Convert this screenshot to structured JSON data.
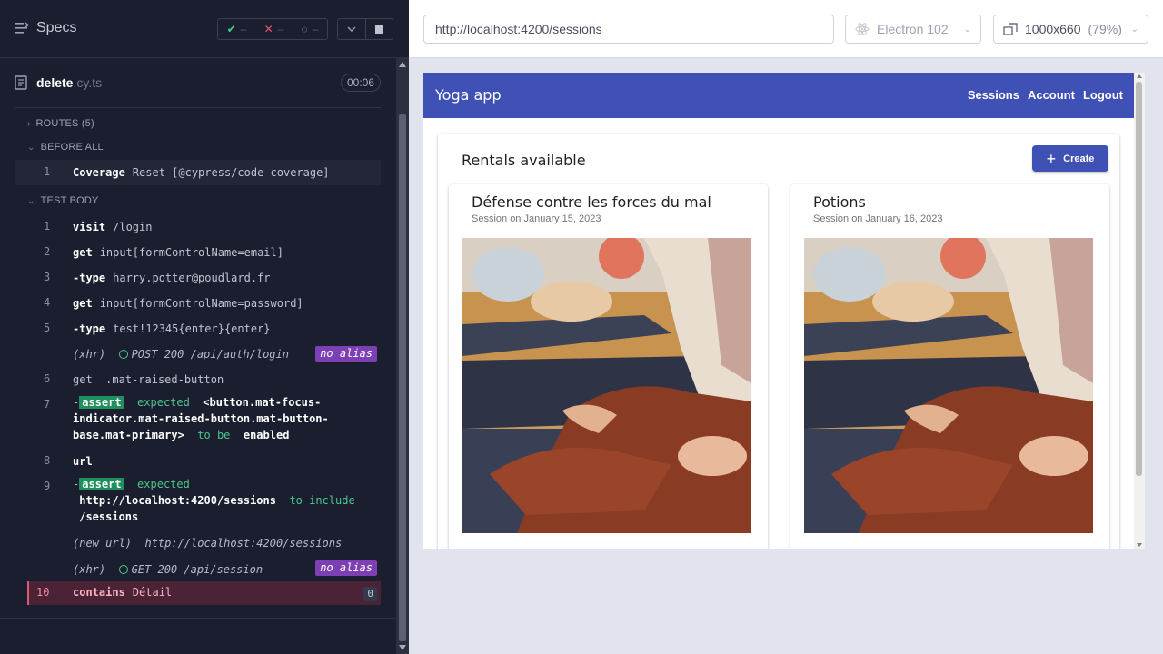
{
  "reporter": {
    "specs_label": "Specs",
    "stats": {
      "passed": "–",
      "failed": "–",
      "pending": "–"
    },
    "file": {
      "base": "delete",
      "ext": ".cy.ts",
      "duration": "00:06"
    },
    "sections": {
      "routes": "ROUTES (5)",
      "before_all": "BEFORE ALL",
      "test_body": "TEST BODY"
    },
    "coverage": {
      "num": "1",
      "name": "Coverage",
      "arg": "Reset [@cypress/code-coverage]"
    },
    "commands": [
      {
        "num": "1",
        "name": "visit",
        "arg": "/login"
      },
      {
        "num": "2",
        "name": "get",
        "arg": "input[formControlName=email]"
      },
      {
        "num": "3",
        "name": "-type",
        "arg": "harry.potter@poudlard.fr"
      },
      {
        "num": "4",
        "name": "get",
        "arg": "input[formControlName=password]"
      },
      {
        "num": "5",
        "name": "-type",
        "arg": "test!12345{enter}{enter}"
      },
      {
        "num": "6",
        "name": "get",
        "arg": ".mat-raised-button"
      },
      {
        "num": "8",
        "name": "url",
        "arg": ""
      }
    ],
    "xhr1": {
      "type": "(xhr)",
      "text": "POST 200 /api/auth/login",
      "alias": "no alias"
    },
    "assert1": {
      "num": "7",
      "dash": "-",
      "tag": "assert",
      "expected": "expected",
      "line1": "<button.mat-focus-",
      "line2": "indicator.mat-raised-button.mat-button-",
      "line3": "base.mat-primary>",
      "to_be": "to be",
      "enabled": "enabled"
    },
    "assert2": {
      "num": "9",
      "dash": "-",
      "tag": "assert",
      "expected": "expected",
      "url": "http://localhost:4200/sessions",
      "to_include": "to include",
      "path": "/sessions"
    },
    "new_url": {
      "type": "(new url)",
      "text": "http://localhost:4200/sessions"
    },
    "xhr2": {
      "type": "(xhr)",
      "text": "GET 200 /api/session",
      "alias": "no alias"
    },
    "failed": {
      "num": "10",
      "name": "contains",
      "arg": "Détail",
      "count": "0"
    }
  },
  "browser": {
    "url": "http://localhost:4200/sessions",
    "browser_name": "Electron 102",
    "viewport": "1000x660",
    "zoom": "(79%)"
  },
  "app": {
    "title": "Yoga app",
    "nav": [
      "Sessions",
      "Account",
      "Logout"
    ],
    "card_title": "Rentals available",
    "create_label": "Create",
    "sessions": [
      {
        "title": "Défense contre les forces du mal",
        "subtitle": "Session on January 15, 2023"
      },
      {
        "title": "Potions",
        "subtitle": "Session on January 16, 2023"
      }
    ]
  },
  "colors": {
    "reporter_bg": "#1b1e2e",
    "pass": "#4ac78b",
    "fail": "#e45770",
    "alias_purple": "#7d3fb4",
    "app_primary": "#3f51b5"
  }
}
